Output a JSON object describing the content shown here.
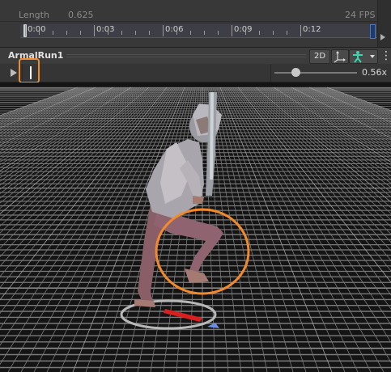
{
  "timeline": {
    "length_label": "Length",
    "length_value": "0.625",
    "fps": "24 FPS",
    "ruler_labels": [
      "0:00",
      "0:03",
      "0:06",
      "0:09",
      "0:12"
    ]
  },
  "preview": {
    "clip_name": "ArmalRun1",
    "btn_2d": "2D",
    "pivot_icon": "pivot-icon",
    "avatar_icon": "avatar-body-icon",
    "menu_icon": "kebab-menu-icon"
  },
  "playback": {
    "play_icon": "play-icon",
    "speed_value": "0.56x",
    "speed_fraction": 0.25
  },
  "colors": {
    "annotation": "#f28a2b",
    "avatar_icon": "#3bd6b0",
    "ruler_end": "#4d78c0"
  }
}
